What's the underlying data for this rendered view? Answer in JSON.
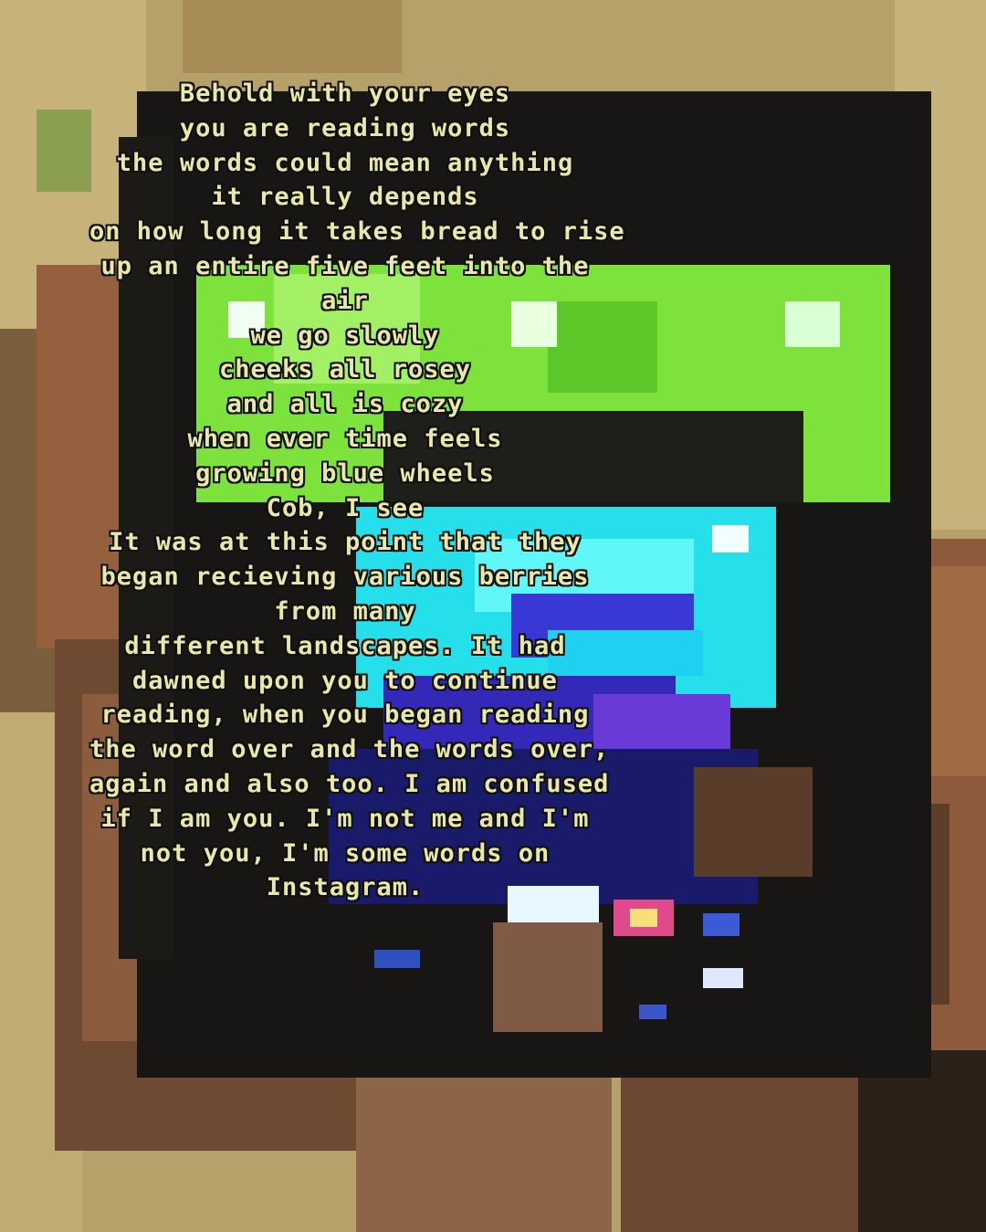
{
  "image": {
    "description_icon": "pixelated-photo-of-hand-holding-phone",
    "palette": {
      "background_tan": "#b9a46e",
      "phone_black": "#151515",
      "screen_green": "#7ee23c",
      "screen_cyan": "#2ff0f0",
      "screen_blue": "#3a3ad8",
      "skin": "#8a5a3c",
      "text_fill": "#e9e8a8",
      "text_outline": "#101010"
    }
  },
  "poem": {
    "lines": [
      "Behold with your eyes",
      "you are reading words",
      "the words could mean anything",
      "it really depends",
      "on how long it takes bread to rise",
      "up an entire five feet into the",
      "air",
      "we go slowly",
      "cheeks all rosey",
      "and all is cozy",
      "when ever time feels",
      "growing blue wheels",
      "Cob, I see",
      "It was at this point that they",
      "began recieving various berries",
      "from many",
      "different landscapes. It had",
      "dawned upon you to continue",
      "reading, when you began reading",
      "the word over and the words over,",
      "again and also too. I am confused",
      "if I am you. I'm not me and I'm",
      "not you, I'm some words on",
      "Instagram."
    ]
  }
}
